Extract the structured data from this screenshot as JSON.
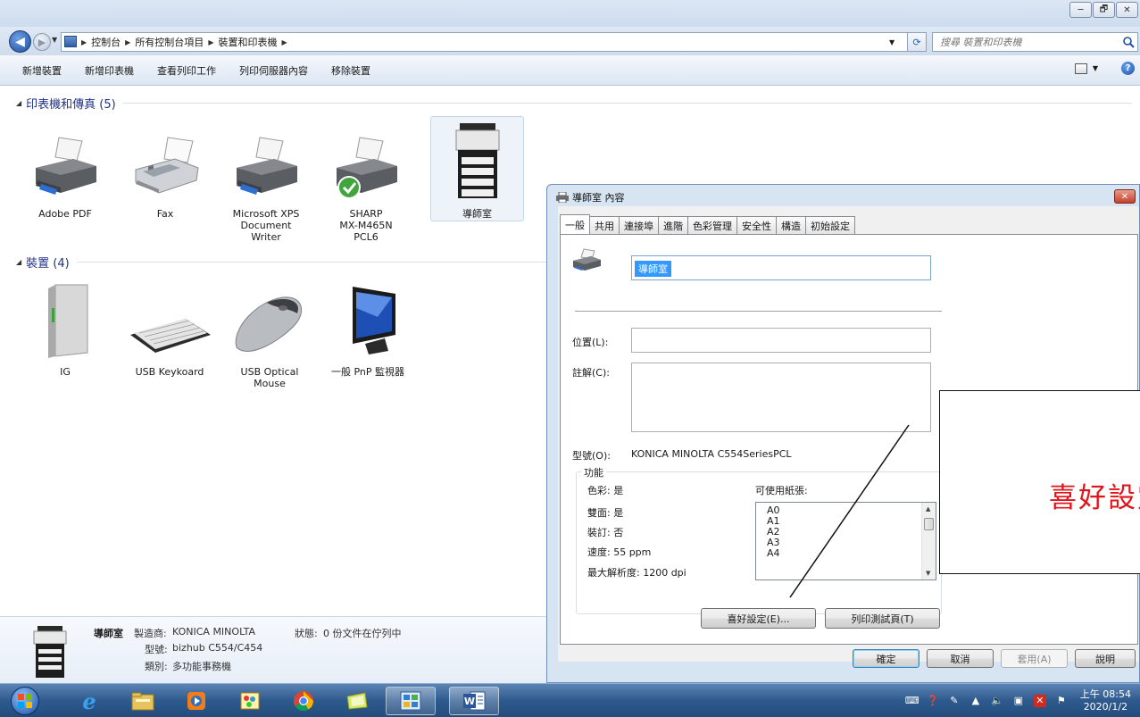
{
  "window": {
    "controls": [
      "─",
      "🗗",
      "✕"
    ]
  },
  "address": {
    "crumbs": [
      "控制台",
      "所有控制台項目",
      "裝置和印表機"
    ],
    "search_placeholder": "搜尋 裝置和印表機"
  },
  "commands": [
    "新增裝置",
    "新增印表機",
    "查看列印工作",
    "列印伺服器內容",
    "移除裝置"
  ],
  "printers_group": {
    "title": "印表機和傳真 (5)",
    "items": [
      {
        "label_lines": [
          "Adobe PDF"
        ]
      },
      {
        "label_lines": [
          "Fax"
        ]
      },
      {
        "label_lines": [
          "Microsoft XPS",
          "Document",
          "Writer"
        ]
      },
      {
        "label_lines": [
          "SHARP",
          "MX-M465N",
          "PCL6"
        ]
      },
      {
        "label_lines": [
          "導師室"
        ]
      }
    ]
  },
  "devices_group": {
    "title": "裝置 (4)",
    "items": [
      {
        "label_lines": [
          "IG"
        ]
      },
      {
        "label_lines": [
          "USB Keykoard"
        ]
      },
      {
        "label_lines": [
          "USB Optical",
          "Mouse"
        ]
      },
      {
        "label_lines": [
          "一般 PnP 監視器"
        ]
      }
    ]
  },
  "details": {
    "name": "導師室",
    "manufacturer_label": "製造商:",
    "manufacturer": "KONICA MINOLTA",
    "status_label": "狀態:",
    "status": "0 份文件在佇列中",
    "model_label": "型號:",
    "model": "bizhub C554/C454",
    "category_label": "類別:",
    "category": "多功能事務機"
  },
  "dialog": {
    "title": "導師室 內容",
    "tabs": [
      "一般",
      "共用",
      "連接埠",
      "進階",
      "色彩管理",
      "安全性",
      "構造",
      "初始設定"
    ],
    "printer_name": "導師室",
    "location_label": "位置(L):",
    "location_value": "",
    "comment_label": "註解(C):",
    "comment_value": "",
    "model_label": "型號(O):",
    "model_value": "KONICA MINOLTA C554SeriesPCL",
    "features_legend": "功能",
    "features": [
      "色彩: 是",
      "雙面: 是",
      "裝訂: 否",
      "速度: 55 ppm",
      "最大解析度: 1200 dpi"
    ],
    "paper_label": "可使用紙張:",
    "paper_sizes": [
      "A0",
      "A1",
      "A2",
      "A3",
      "A4"
    ],
    "preferences_button": "喜好設定(E)...",
    "test_page_button": "列印測試頁(T)",
    "ok_button": "確定",
    "cancel_button": "取消",
    "apply_button": "套用(A)",
    "help_button": "說明"
  },
  "annotation": {
    "text": "喜好設定"
  },
  "clock": {
    "time": "上午 08:54",
    "date": "2020/1/2"
  },
  "colors": {
    "group_header": "#1e3287",
    "selection": "#3399ff",
    "annotation_text": "#e0151b",
    "taskbar": "#2e5a8e"
  }
}
